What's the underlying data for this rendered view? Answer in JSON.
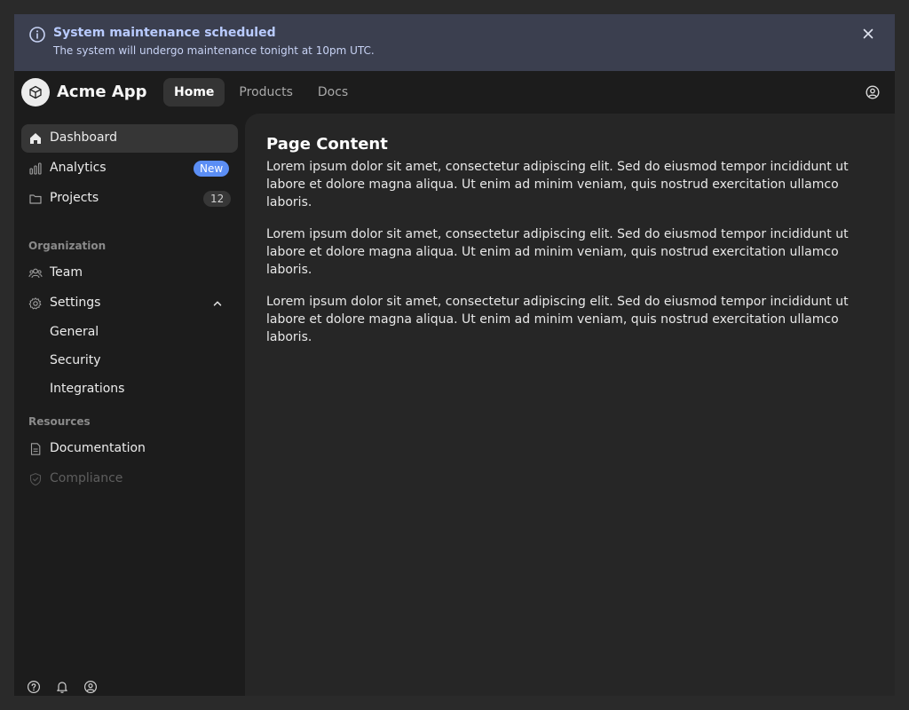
{
  "banner": {
    "title": "System maintenance scheduled",
    "message": "The system will undergo maintenance tonight at 10pm UTC."
  },
  "header": {
    "app_name": "Acme App",
    "nav": [
      "Home",
      "Products",
      "Docs"
    ],
    "active_nav": "Home"
  },
  "sidebar": {
    "items": [
      {
        "label": "Dashboard",
        "icon": "home-icon",
        "active": true
      },
      {
        "label": "Analytics",
        "icon": "bar-chart-icon",
        "badge": "New"
      },
      {
        "label": "Projects",
        "icon": "folder-icon",
        "badge": "12"
      }
    ],
    "sections": [
      {
        "label": "Organization",
        "items": [
          {
            "label": "Team",
            "icon": "users-icon"
          },
          {
            "label": "Settings",
            "icon": "gear-icon",
            "expanded": true,
            "children": [
              "General",
              "Security",
              "Integrations"
            ]
          }
        ]
      },
      {
        "label": "Resources",
        "items": [
          {
            "label": "Documentation",
            "icon": "document-icon"
          },
          {
            "label": "Compliance",
            "icon": "shield-icon",
            "disabled": true
          }
        ]
      }
    ],
    "footer_icons": [
      "help-icon",
      "bell-icon",
      "user-icon"
    ]
  },
  "main": {
    "title": "Page Content",
    "paragraphs": [
      "Lorem ipsum dolor sit amet, consectetur adipiscing elit. Sed do eiusmod tempor incididunt ut labore et dolore magna aliqua. Ut enim ad minim veniam, quis nostrud exercitation ullamco laboris.",
      "Lorem ipsum dolor sit amet, consectetur adipiscing elit. Sed do eiusmod tempor incididunt ut labore et dolore magna aliqua. Ut enim ad minim veniam, quis nostrud exercitation ullamco laboris.",
      "Lorem ipsum dolor sit amet, consectetur adipiscing elit. Sed do eiusmod tempor incididunt ut labore et dolore magna aliqua. Ut enim ad minim veniam, quis nostrud exercitation ullamco laboris."
    ]
  },
  "colors": {
    "accent": "#5b8ef5",
    "banner_bg": "#3b3f4f",
    "banner_title": "#b9cbff"
  }
}
